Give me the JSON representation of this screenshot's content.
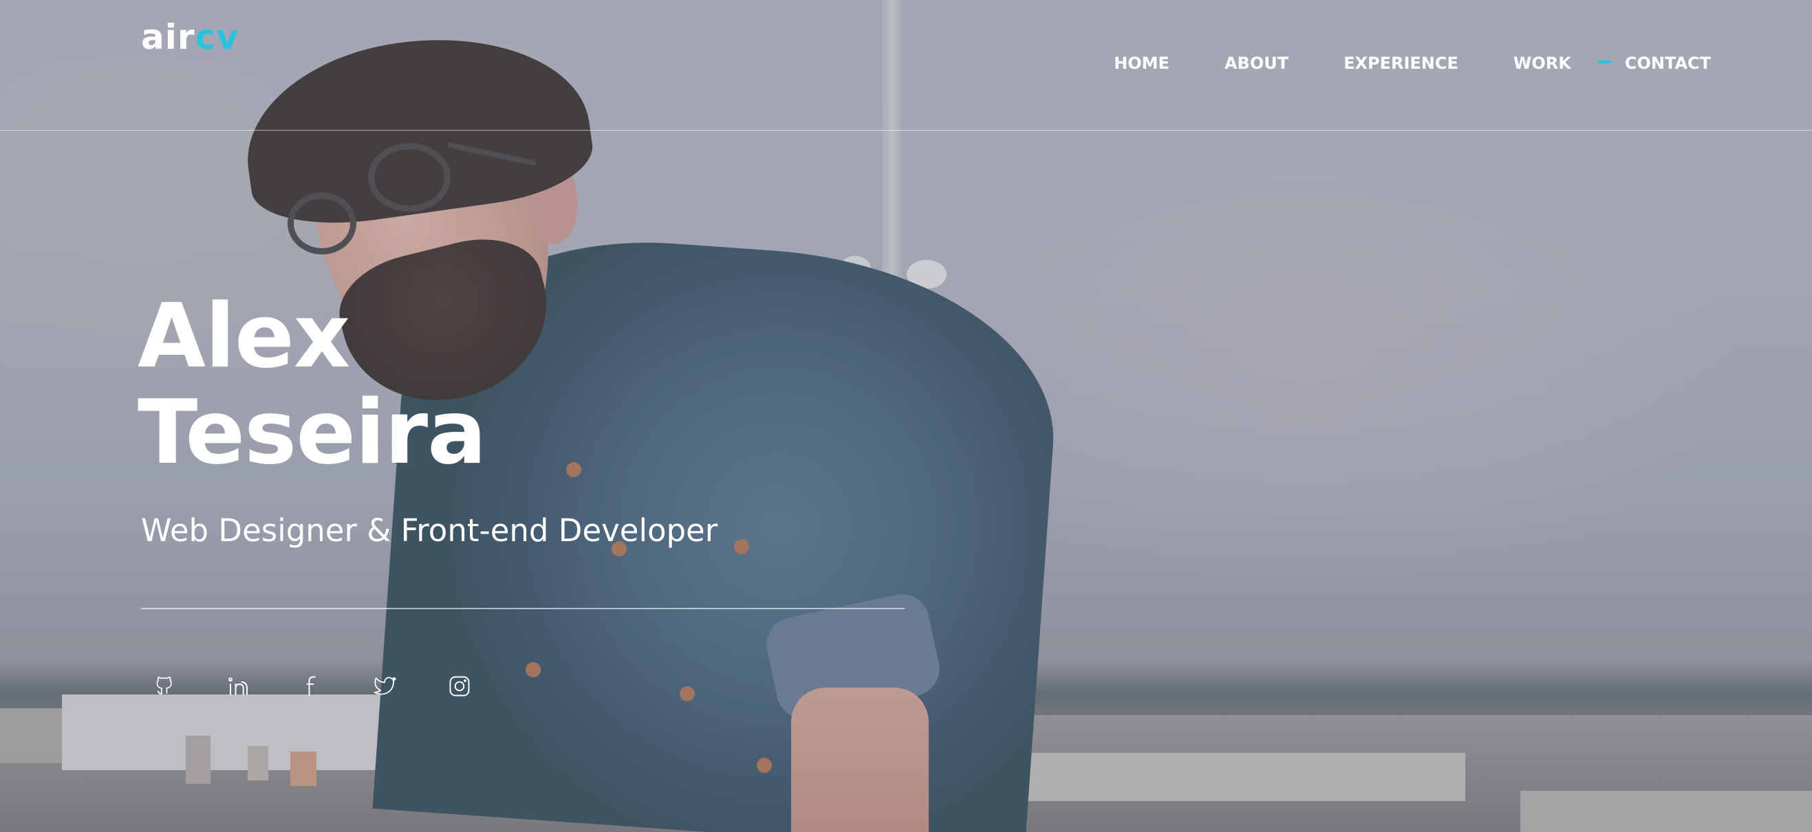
{
  "brand": {
    "logo_part1": "air",
    "logo_part2": "cv",
    "accent_color": "#2ac3db"
  },
  "nav": {
    "items": [
      {
        "label": "HOME",
        "active": false
      },
      {
        "label": "ABOUT",
        "active": false
      },
      {
        "label": "EXPERIENCE",
        "active": false
      },
      {
        "label": "WORK",
        "active": false
      },
      {
        "label": "CONTACT",
        "active": true
      }
    ]
  },
  "hero": {
    "first_name": "Alex",
    "last_name": "Teseira",
    "subtitle": "Web Designer & Front-end Developer"
  },
  "socials": [
    {
      "icon": "github-icon"
    },
    {
      "icon": "linkedin-icon"
    },
    {
      "icon": "facebook-icon"
    },
    {
      "icon": "twitter-icon"
    },
    {
      "icon": "instagram-icon"
    }
  ]
}
